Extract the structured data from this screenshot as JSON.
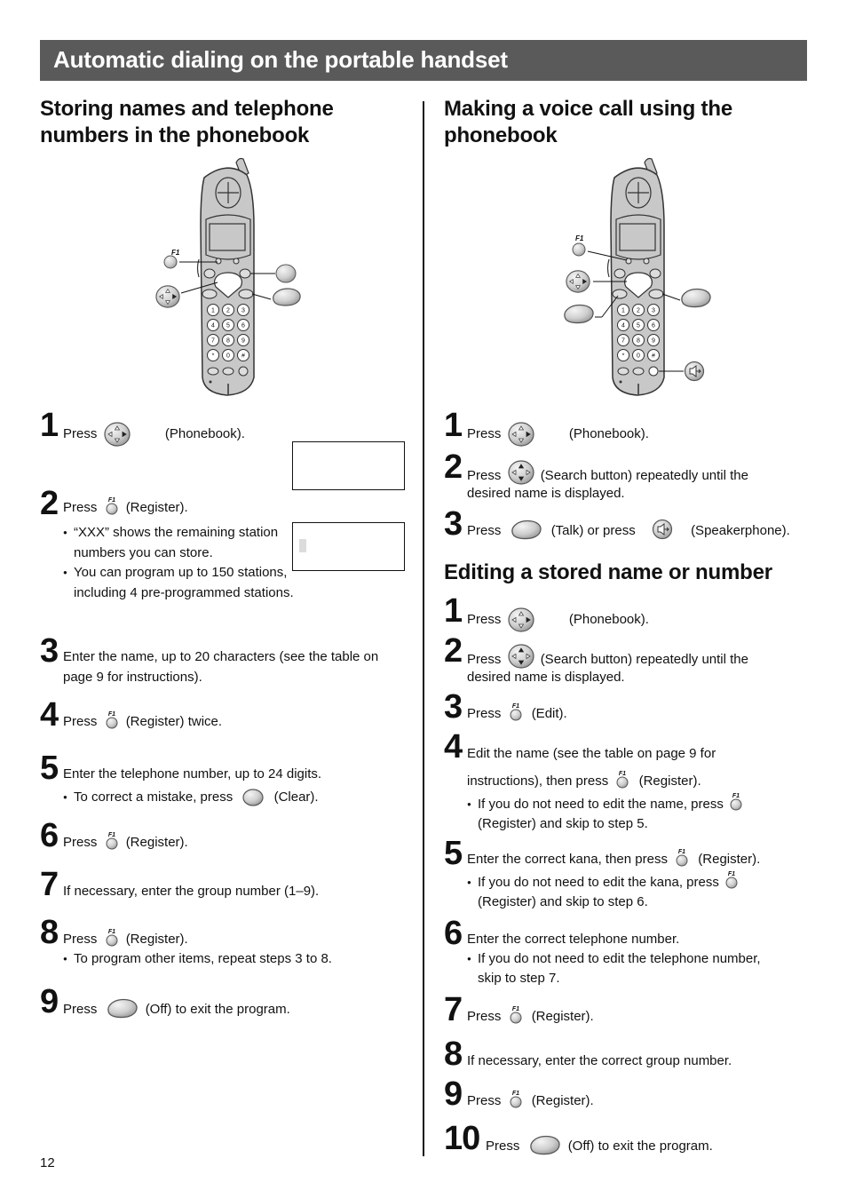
{
  "page": {
    "banner_title": "Automatic dialing on the portable handset",
    "page_number": "12"
  },
  "left": {
    "title_line1": "Storing names and telephone",
    "title_line2": "numbers in the phonebook",
    "steps": [
      {
        "num": "1",
        "press": "Press",
        "label": "(Phonebook)."
      },
      {
        "num": "2",
        "press": "Press",
        "label": "(Register).",
        "bullets": [
          "“XXX” shows the remaining station numbers you can store.",
          "You can program up to 150 stations, including 4 pre-programmed stations."
        ]
      },
      {
        "num": "3",
        "text_line1": "Enter the name, up to 20 characters (see the table on",
        "text_line2": "page 9 for instructions)."
      },
      {
        "num": "4",
        "press": "Press",
        "label": "(Register) twice."
      },
      {
        "num": "5",
        "text": "Enter the telephone number, up to 24 digits.",
        "bullet_prefix": "To correct a mistake, press",
        "bullet_label": "(Clear)."
      },
      {
        "num": "6",
        "press": "Press",
        "label": "(Register)."
      },
      {
        "num": "7",
        "text": "If necessary, enter the group number (1–9)."
      },
      {
        "num": "8",
        "press": "Press",
        "label": "(Register).",
        "bullet": "To program other items, repeat steps 3 to 8."
      },
      {
        "num": "9",
        "press": "Press",
        "label": "(Off) to exit the program."
      }
    ]
  },
  "right": {
    "title_line1": "Making a voice call using the",
    "title_line2": "phonebook",
    "call_steps": [
      {
        "num": "1",
        "press": "Press",
        "label": "(Phonebook)."
      },
      {
        "num": "2",
        "press": "Press",
        "label": "(Search button) repeatedly until the",
        "line2": "desired name is displayed."
      },
      {
        "num": "3",
        "press": "Press",
        "label": "(Talk) or press",
        "label2": "(Speakerphone)."
      }
    ],
    "edit_title": "Editing a stored name or number",
    "edit_steps": [
      {
        "num": "1",
        "press": "Press",
        "label": "(Phonebook)."
      },
      {
        "num": "2",
        "press": "Press",
        "label": "(Search button) repeatedly until the",
        "line2": "desired name is displayed."
      },
      {
        "num": "3",
        "press": "Press",
        "label": "(Edit)."
      },
      {
        "num": "4",
        "line1": "Edit the name (see the table on page 9 for",
        "line2_prefix": "instructions), then press",
        "line2_label": "(Register).",
        "bullet_prefix": "If you do not need to edit the name, press",
        "bullet_line2": "(Register) and skip to step 5."
      },
      {
        "num": "5",
        "prefix": "Enter the correct kana, then press",
        "label": "(Register).",
        "bullet_prefix": "If you do not need to edit the kana, press",
        "bullet_line2": "(Register) and skip to step 6."
      },
      {
        "num": "6",
        "text": "Enter the correct telephone number.",
        "bullet_line1": "If you do not need to edit the telephone number,",
        "bullet_line2": "skip to step 7."
      },
      {
        "num": "7",
        "press": "Press",
        "label": "(Register)."
      },
      {
        "num": "8",
        "text": "If necessary, enter the correct group number."
      },
      {
        "num": "9",
        "press": "Press",
        "label": "(Register)."
      },
      {
        "num": "10",
        "press": "Press",
        "label": "(Off) to exit the program."
      }
    ]
  },
  "handset": {
    "keypad": [
      "1",
      "2",
      "3",
      "4",
      "5",
      "6",
      "7",
      "8",
      "9",
      "*",
      "0",
      "#"
    ],
    "soft_key_label": "F1"
  },
  "icons": {
    "phonebook": "navigator-right-pressed-icon",
    "search": "navigator-up-down-icon",
    "register": "soft-key-f1-icon",
    "clear": "clear-button-icon",
    "talk": "talk-button-icon",
    "off": "off-button-icon",
    "speakerphone": "speakerphone-icon"
  },
  "colors": {
    "banner_bg": "#5a5a5a",
    "banner_text": "#ffffff",
    "handset_body": "#c8c8c8"
  }
}
